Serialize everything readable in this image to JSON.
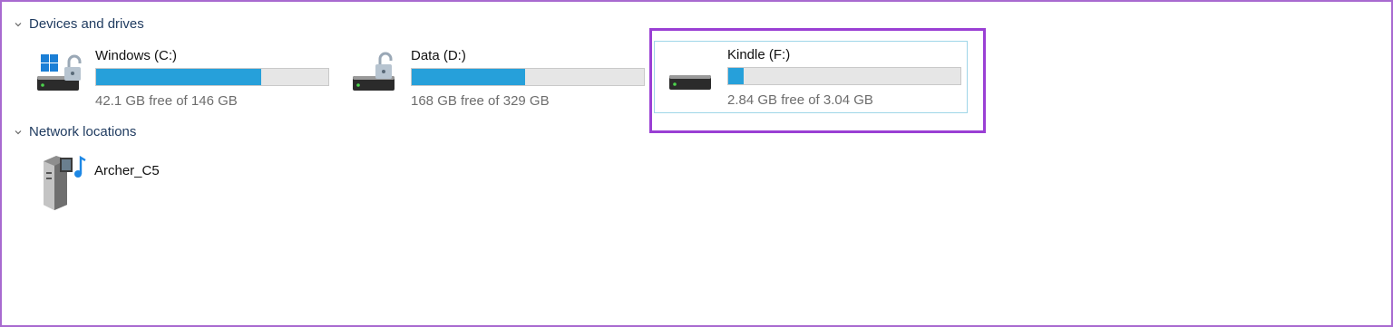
{
  "groups": {
    "devices": {
      "label": "Devices and drives",
      "drives": [
        {
          "name": "Windows (C:)",
          "free_text": "42.1 GB free of 146 GB",
          "used_fraction": 0.712,
          "icon": "windows-drive-locked-icon"
        },
        {
          "name": "Data (D:)",
          "free_text": "168 GB free of 329 GB",
          "used_fraction": 0.489,
          "icon": "drive-locked-icon"
        },
        {
          "name": "Kindle (F:)",
          "free_text": "2.84 GB free of 3.04 GB",
          "used_fraction": 0.066,
          "icon": "drive-icon",
          "selected": true
        }
      ]
    },
    "network": {
      "label": "Network locations",
      "items": [
        {
          "name": "Archer_C5",
          "icon": "media-server-icon"
        }
      ]
    }
  },
  "colors": {
    "accent_bar": "#26a0da",
    "highlight_border": "#9a3fd4",
    "group_header": "#1e3a5f"
  }
}
